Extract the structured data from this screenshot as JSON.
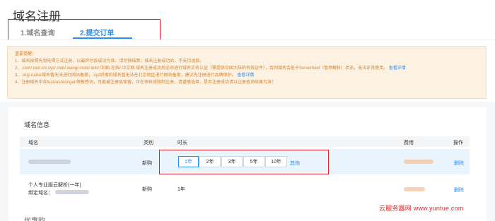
{
  "page_title": "域名注册",
  "tabs": [
    {
      "label": "1.域名查询",
      "active": false
    },
    {
      "label": "2.提交订单",
      "active": true
    }
  ],
  "notice": {
    "heading": "重要提醒：",
    "items": [
      "1、域名按照先到先得方式注册，以最终付款成功为准，请尽快结算；域名注册成功后，不支持退款。",
      "2、.com/.net/.cn/.xyz/.club/.wang/.mobi/.info/.中国/.在线/.中文网 域名注册成功后必须进行域名实名认证（需提供中国大陆的有效证件），否则域名会处于Serverhold（暂停解析）状态，无法正常使用。",
      "3、.org/.name域名暂无法进行网站备案，.xyz后缀的域名暂无法在北京地区进行网站备案，建议先注册进行品牌保护。",
      "4、注册域名中含fuck/av/xiongan等敏感词，可能被注册局保留，正在审核或限制注册。请谨慎选择，是否注册成功请以注册查询结果为准！"
    ],
    "link_2": "查看详情",
    "link_3": "查看详情"
  },
  "section_title": "域名信息",
  "table": {
    "headers": {
      "domain": "域名",
      "type": "类别",
      "duration": "时长",
      "cost": "费用",
      "action": "操作"
    },
    "rows": [
      {
        "type": "新购",
        "durations": [
          "1年",
          "2年",
          "3年",
          "5年",
          "10年"
        ],
        "selected_duration": "1年",
        "other_label": "其他",
        "action": "删除"
      },
      {
        "product_name": "个人专业版云解析(一年)",
        "bind_label": "绑定域名：",
        "type": "新购",
        "duration": "1年",
        "action": "删除"
      }
    ]
  },
  "watermark": "云服务器网 www.yuntue.com",
  "next_section_title": "优惠购买"
}
